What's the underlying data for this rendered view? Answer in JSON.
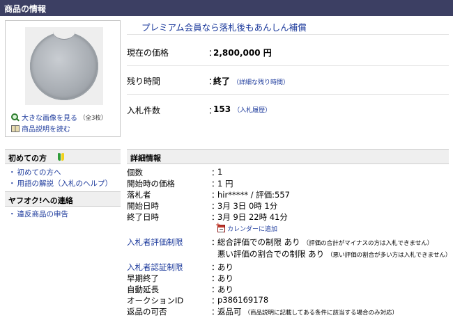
{
  "header": {
    "title": "商品の情報"
  },
  "image_panel": {
    "large_image_link": "大きな画像を見る",
    "large_image_note": "（全3枚）",
    "description_link": "商品説明を読む"
  },
  "promo": {
    "text": "プレミアム会員なら落札後もあんしん補償"
  },
  "summary": {
    "price": {
      "label": "現在の価格",
      "colon": "：",
      "value": "2,800,000 円"
    },
    "time_left": {
      "label": "残り時間",
      "colon": "：",
      "value": "終了",
      "link": "（詳細な残り時間）"
    },
    "bids": {
      "label": "入札件数",
      "colon": "：",
      "value": "153",
      "link": "（入札履歴）"
    }
  },
  "sidebar": {
    "beginners": {
      "title": "初めての方",
      "links": [
        "初めての方へ",
        "用語の解説（入札のヘルプ）"
      ]
    },
    "contact": {
      "title": "ヤフオク!への連絡",
      "links": [
        "違反商品の申告"
      ]
    }
  },
  "details": {
    "title": "詳細情報",
    "rows": [
      {
        "label": "個数",
        "value": "1"
      },
      {
        "label": "開始時の価格",
        "value": "1 円"
      },
      {
        "label": "落札者",
        "value": "hir***** / 評価:557"
      },
      {
        "label": "開始日時",
        "value": "3月 3日 0時 1分"
      },
      {
        "label": "終了日時",
        "value": "3月 9日 22時 41分"
      }
    ],
    "calendar_link": "カレンダーに追加",
    "rating_restriction": {
      "label": "入札者評価制限",
      "line1": "総合評価での制限 あり",
      "line1_note": "（評価の合計がマイナスの方は入札できません）",
      "line2": "悪い評価の割合での制限 あり",
      "line2_note": "（悪い評価の割合が多い方は入札できません）"
    },
    "rows2": [
      {
        "label": "入札者認証制限",
        "value": "あり"
      },
      {
        "label": "早期終了",
        "value": "あり"
      },
      {
        "label": "自動延長",
        "value": "あり"
      },
      {
        "label": "オークションID",
        "value": "p386169178"
      },
      {
        "label": "返品の可否",
        "value": "返品可",
        "note": "（商品説明に記載してある条件に該当する場合のみ対応）"
      }
    ],
    "colon": "："
  }
}
